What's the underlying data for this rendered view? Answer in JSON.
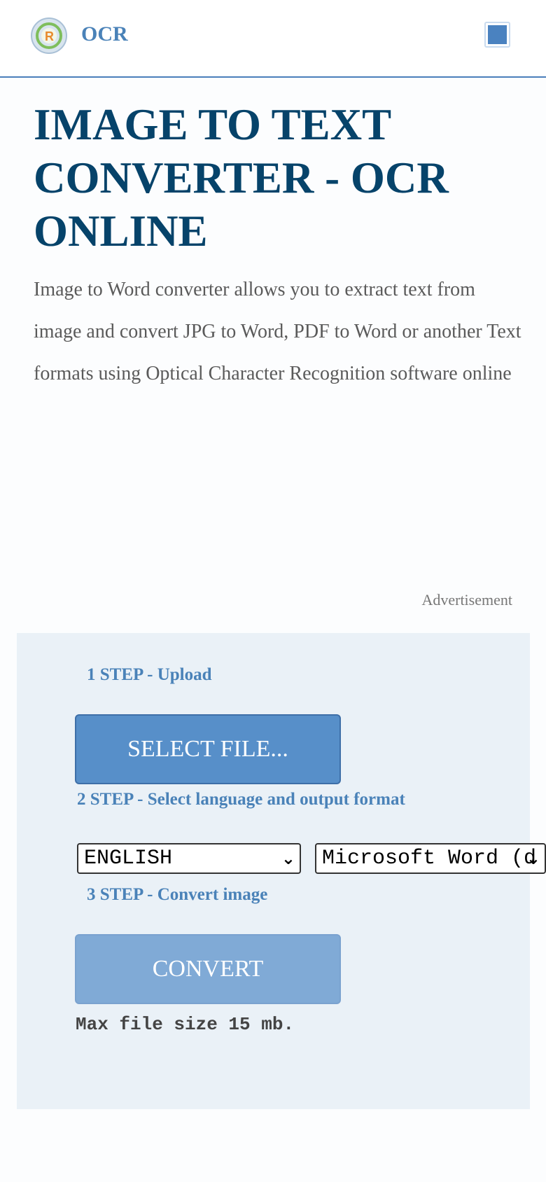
{
  "header": {
    "brand": "OCR",
    "logo_letter": "R"
  },
  "main": {
    "title": "IMAGE TO TEXT CONVERTER - OCR ONLINE",
    "description": "Image to Word converter allows you to extract text from image and convert JPG to Word, PDF to Word or another Text formats using Optical Character Recognition software online"
  },
  "ad": {
    "label": "Advertisement"
  },
  "converter": {
    "step1_label": "1 STEP - Upload",
    "select_file_label": "SELECT FILE...",
    "step2_label": "2 STEP - Select language and output format",
    "language_value": "ENGLISH",
    "format_value": "Microsoft Word (d",
    "step3_label": "3 STEP - Convert image",
    "convert_label": "CONVERT",
    "max_size_note": "Max file size 15 mb."
  },
  "colors": {
    "accent": "#4a82b8",
    "title": "#06436a",
    "panel_bg": "#eaf1f7",
    "button": "#578fc9",
    "button_disabled": "#80aad6"
  }
}
